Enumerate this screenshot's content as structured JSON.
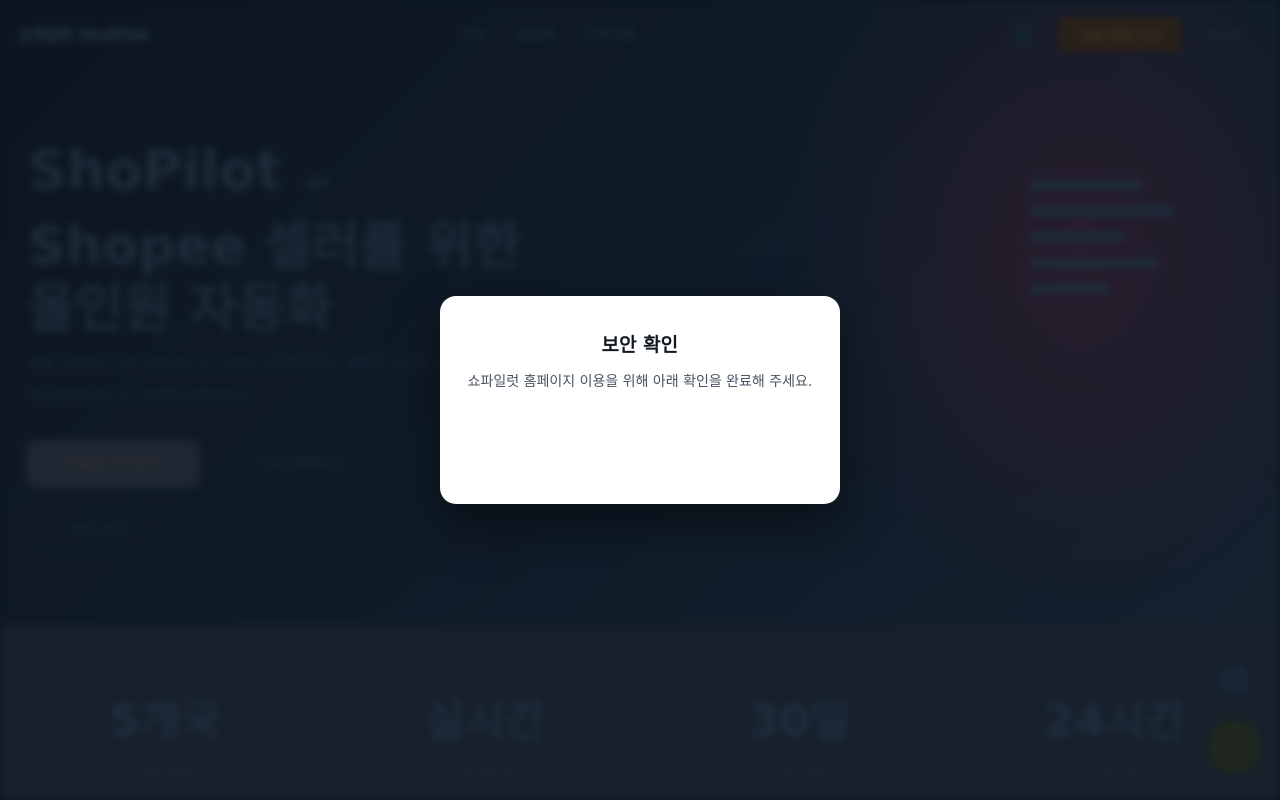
{
  "background": {
    "nav": {
      "logo": "쇼파일럿 ShoPilot",
      "links": [
        "기능",
        "요금제",
        "고객사례"
      ],
      "cta": "무료 체험 시작",
      "login": "로그인"
    },
    "hero": {
      "brand": "ShoPilot",
      "badge": "베타",
      "line1": "Shopee 셀러를 위한",
      "line2": "올인원 자동화",
      "desc": "상품 등록부터 주문 관리까지 한 곳에서 자동화하세요. 복잡한 작업은 쇼파일럿에게 맡기고 판매에 집중하세요.",
      "primary_button": "무료로 시작하기",
      "secondary_button": "기능 살펴보기",
      "tertiary_button": "데모 보기"
    },
    "stats": [
      {
        "value": "5개국",
        "label": "지원 마켓"
      },
      {
        "value": "실시간",
        "label": "주문 동기화"
      },
      {
        "value": "30일",
        "label": "무료 체험"
      },
      {
        "value": "24시간",
        "label": "고객 지원"
      }
    ]
  },
  "modal": {
    "title": "보안 확인",
    "description": "쇼파일럿 홈페이지 이용을 위해 아래 확인을 완료해 주세요."
  }
}
